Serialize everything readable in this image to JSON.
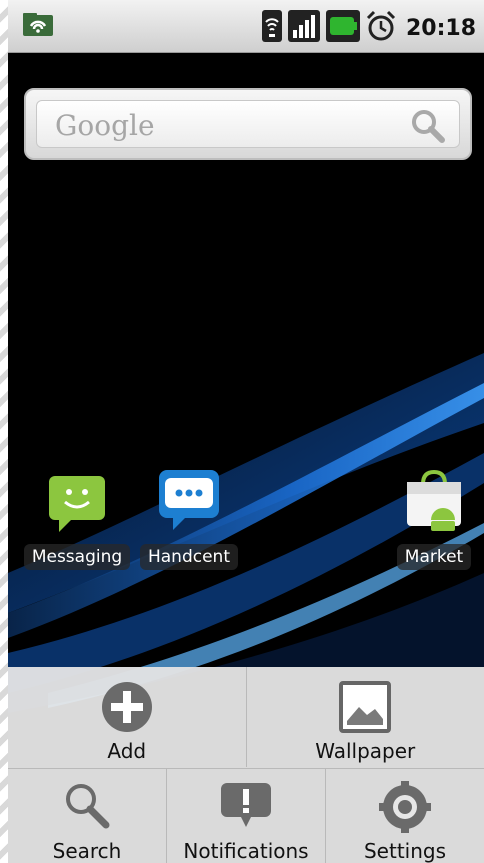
{
  "status_bar": {
    "time": "20:18",
    "icons": [
      "notification-download-icon",
      "wifi-icon",
      "signal-icon",
      "battery-icon",
      "alarm-icon"
    ]
  },
  "search_widget": {
    "placeholder": "Google"
  },
  "apps": [
    {
      "label": "Messaging",
      "icon": "messaging-icon"
    },
    {
      "label": "Handcent",
      "icon": "handcent-icon"
    },
    {
      "label": "Market",
      "icon": "market-icon"
    }
  ],
  "menu": {
    "items": [
      {
        "label": "Add",
        "icon": "add-icon"
      },
      {
        "label": "Wallpaper",
        "icon": "wallpaper-icon"
      },
      {
        "label": "Search",
        "icon": "search-icon"
      },
      {
        "label": "Notifications",
        "icon": "notifications-icon"
      },
      {
        "label": "Settings",
        "icon": "settings-icon"
      }
    ]
  },
  "colors": {
    "status_bar_bg": "#dcdcdc",
    "wallpaper_base": "#000000",
    "wallpaper_wave": "#1c6fd6",
    "menu_bg": "#ebebeb",
    "battery_green": "#2fb52f"
  }
}
